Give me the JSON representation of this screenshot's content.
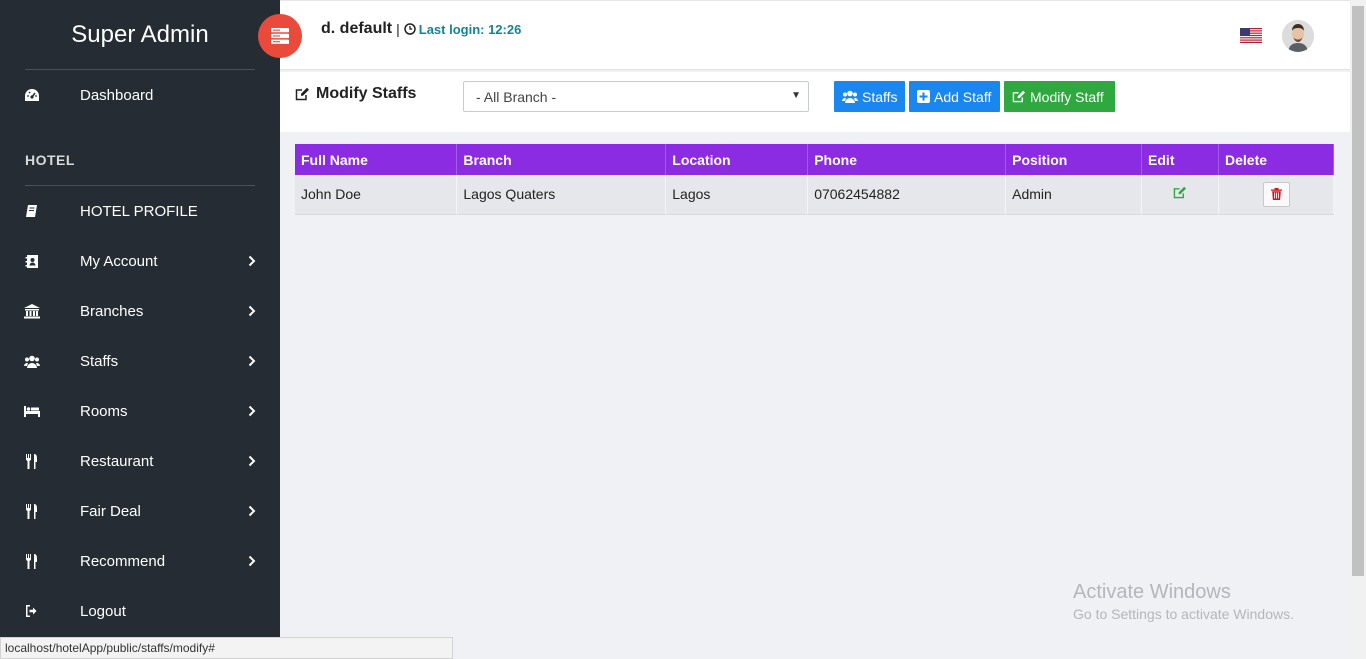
{
  "sidebar": {
    "brand": "Super Admin",
    "section_label": "HOTEL",
    "items": [
      {
        "label": "Dashboard",
        "icon": "dashboard-icon",
        "chevron": false
      },
      {
        "label": "HOTEL PROFILE",
        "icon": "book-icon",
        "chevron": false
      },
      {
        "label": "My Account",
        "icon": "contact-book-icon",
        "chevron": true
      },
      {
        "label": "Branches",
        "icon": "bank-icon",
        "chevron": true
      },
      {
        "label": "Staffs",
        "icon": "users-icon",
        "chevron": true
      },
      {
        "label": "Rooms",
        "icon": "bed-icon",
        "chevron": true
      },
      {
        "label": "Restaurant",
        "icon": "cutlery-icon",
        "chevron": true
      },
      {
        "label": "Fair Deal",
        "icon": "cutlery-icon",
        "chevron": true
      },
      {
        "label": "Recommend",
        "icon": "cutlery-icon",
        "chevron": true
      },
      {
        "label": "Logout",
        "icon": "sign-out-icon",
        "chevron": false
      }
    ]
  },
  "header": {
    "user": "d. default",
    "separator": "|",
    "last_login": "Last login: 12:26"
  },
  "toolbar": {
    "title": "Modify Staffs",
    "branch_select": "- All Branch -",
    "buttons": {
      "staffs": "Staffs",
      "add_staff": "Add Staff",
      "modify_staff": "Modify Staff"
    }
  },
  "table": {
    "columns": [
      "Full Name",
      "Branch",
      "Location",
      "Phone",
      "Position",
      "Edit",
      "Delete"
    ],
    "rows": [
      {
        "full_name": "John Doe",
        "branch": "Lagos Quaters",
        "location": "Lagos",
        "phone": "07062454882",
        "position": "Admin"
      }
    ]
  },
  "watermark": {
    "line1": "Activate Windows",
    "line2": "Go to Settings to activate Windows."
  },
  "status_bar": {
    "url": "localhost/hotelApp/public/staffs/modify#"
  },
  "colors": {
    "sidebar_bg": "#262c33",
    "toggle_red": "#e94a3c",
    "table_header": "#8b2be2",
    "primary": "#1a86f0",
    "success": "#2fa83f",
    "login_teal": "#138496"
  }
}
